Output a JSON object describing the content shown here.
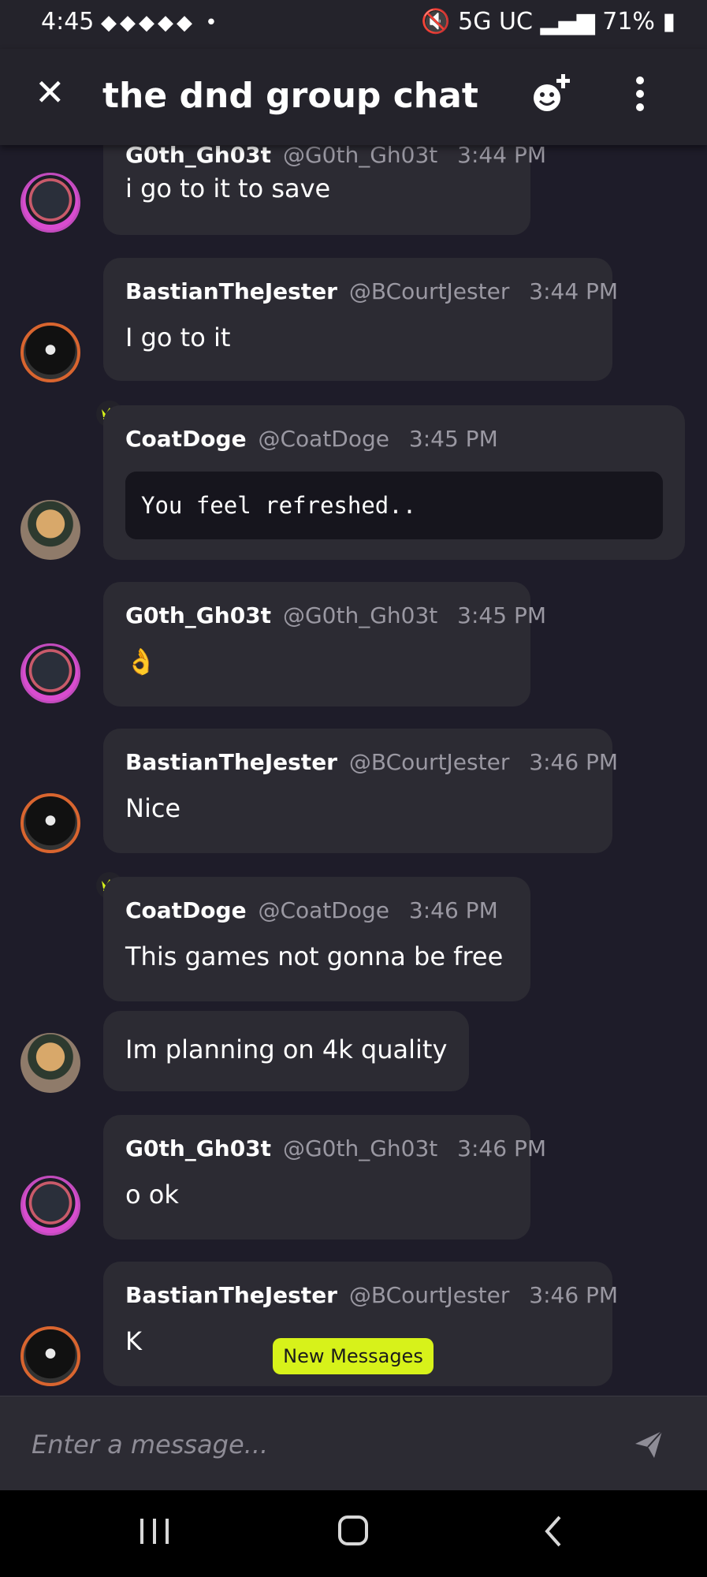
{
  "status": {
    "time": "4:45",
    "network": "5G UC",
    "battery": "71%"
  },
  "header": {
    "title": "the dnd group chat"
  },
  "messages": [
    {
      "name": "G0th_Gh03t",
      "handle": "@G0th_Gh03t",
      "time": "3:44 PM",
      "lines": [
        "i go to it to save"
      ]
    },
    {
      "name": "BastianTheJester",
      "handle": "@BCourtJester",
      "time": "3:44 PM",
      "lines": [
        "I go to it"
      ]
    },
    {
      "name": "CoatDoge",
      "handle": "@CoatDoge",
      "time": "3:45 PM",
      "code": "You feel refreshed.."
    },
    {
      "name": "G0th_Gh03t",
      "handle": "@G0th_Gh03t",
      "time": "3:45 PM",
      "lines": [
        "👌"
      ]
    },
    {
      "name": "BastianTheJester",
      "handle": "@BCourtJester",
      "time": "3:46 PM",
      "lines": [
        "Nice"
      ]
    },
    {
      "name": "CoatDoge",
      "handle": "@CoatDoge",
      "time": "3:46 PM",
      "lines": [
        "This games not gonna be free"
      ]
    },
    {
      "lines": [
        "Im planning on 4k quality"
      ]
    },
    {
      "name": "G0th_Gh03t",
      "handle": "@G0th_Gh03t",
      "time": "3:46 PM",
      "lines": [
        "o ok"
      ]
    },
    {
      "name": "BastianTheJester",
      "handle": "@BCourtJester",
      "time": "3:46 PM",
      "lines": [
        "K"
      ]
    }
  ],
  "new_messages_label": "New Messages",
  "composer": {
    "placeholder": "Enter a message..."
  },
  "icons": {
    "close": "close-icon",
    "add_member": "add-emoji-person-icon",
    "menu": "more-vertical-icon",
    "send": "send-icon",
    "crown": "crown-icon"
  },
  "colors": {
    "background": "#1e1c29",
    "bubble": "#2c2b33",
    "accent": "#d7f21a"
  }
}
